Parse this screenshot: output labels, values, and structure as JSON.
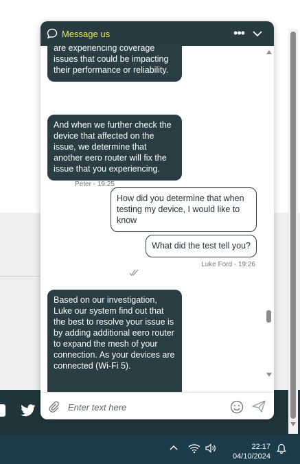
{
  "widget": {
    "title": "Message us",
    "menu_label": "•••",
    "input_placeholder": "Enter text here"
  },
  "messages": [
    {
      "from": "agent",
      "text": "are experiencing coverage issues that could be impacting their performance or reliability."
    },
    {
      "from": "agent",
      "text": "And when we further check the device that affected on the issue, we determine that another eero router will fix the issue that you experiencing."
    },
    {
      "from": "user",
      "text": "How did you determine that when testing my device, I would like to know"
    },
    {
      "from": "user",
      "text": "What did the test tell you?"
    },
    {
      "from": "agent",
      "text": "Based on our investigation, Luke our system find out that the best to resolve your issue is by adding additional eero router to expand the mesh of your connection. As your devices are connected (Wi-Fi 5)."
    }
  ],
  "meta": {
    "agent_meta": "Peter - 19:25",
    "user_meta": "Luke Ford - 19:26"
  },
  "taskbar": {
    "time": "22:17",
    "date": "04/10/2024"
  },
  "colors": {
    "header_bg": "#283b43",
    "title_accent": "#e6f04a",
    "agent_bubble": "#2a3d44",
    "footer_bg": "#21343c",
    "taskbar_bg": "#1c3c4c"
  },
  "icons": [
    "chat-bubble-icon",
    "more-icon",
    "chevron-down-icon",
    "paperclip-icon",
    "emoji-icon",
    "send-icon",
    "twitter-icon",
    "tray-chevron-icon",
    "wifi-icon",
    "volume-icon",
    "notification-bell-icon",
    "read-ticks-icon"
  ]
}
